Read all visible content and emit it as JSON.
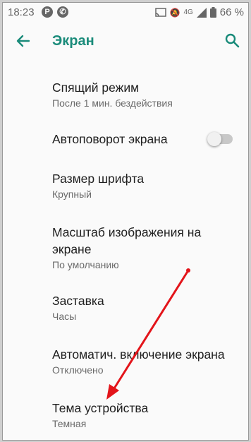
{
  "status_bar": {
    "time": "18:23",
    "app_icon_1": "P",
    "app_icon_2": "signal-app-icon",
    "network": "4G",
    "battery": "66 %"
  },
  "toolbar": {
    "title": "Экран"
  },
  "settings": [
    {
      "title": "Спящий режим",
      "subtitle": "После 1 мин. бездействия"
    },
    {
      "title": "Автоповорот экрана",
      "toggle_on": false
    },
    {
      "title": "Размер шрифта",
      "subtitle": "Крупный"
    },
    {
      "title_lines": [
        "Масштаб изображения на",
        "экране"
      ],
      "subtitle": "По умолчанию"
    },
    {
      "title": "Заставка",
      "subtitle": "Часы"
    },
    {
      "title": "Автоматич. включение экрана",
      "subtitle": "Отключено"
    },
    {
      "title": "Тема устройства",
      "subtitle": "Темная"
    }
  ],
  "colors": {
    "accent": "#1a8b7a",
    "annotation_arrow": "#e3141a"
  }
}
